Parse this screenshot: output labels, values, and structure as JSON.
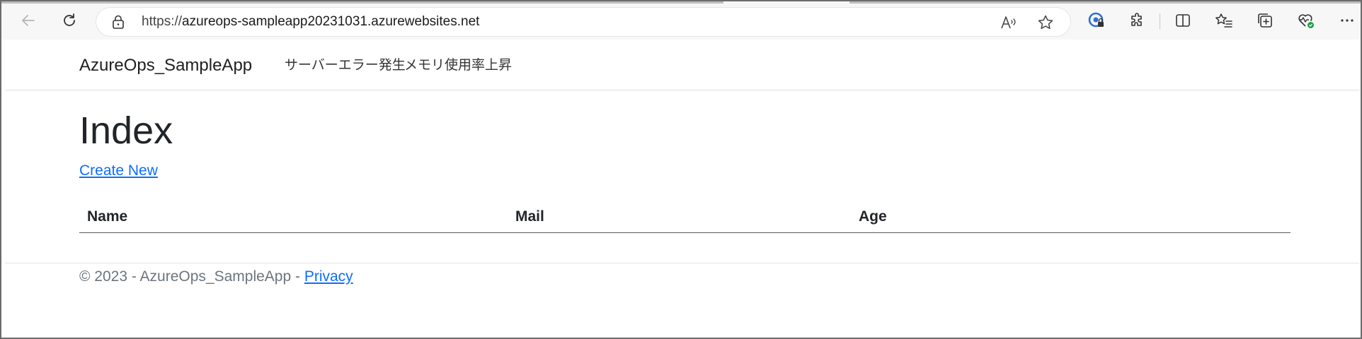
{
  "browser": {
    "url_host": "azureops-sampleapp20231031.azurewebsites.net",
    "url_scheme": "https://"
  },
  "nav": {
    "brand": "AzureOps_SampleApp",
    "links": [
      "サーバーエラー発生",
      "メモリ使用率上昇"
    ]
  },
  "main": {
    "title": "Index",
    "create_link": "Create New",
    "table_headers": [
      "Name",
      "Mail",
      "Age"
    ]
  },
  "footer": {
    "text": "© 2023 - AzureOps_SampleApp - ",
    "privacy_link": "Privacy"
  },
  "colors": {
    "link": "#0d6efd",
    "footer_text": "#6c757d",
    "heading": "#212529"
  },
  "icons": [
    "back-arrow-icon",
    "refresh-icon",
    "lock-icon",
    "read-aloud-icon",
    "favorite-star-icon",
    "password-manager-icon",
    "extensions-icon",
    "split-screen-icon",
    "favorites-icon",
    "collections-icon",
    "browser-essentials-icon",
    "more-icon"
  ]
}
